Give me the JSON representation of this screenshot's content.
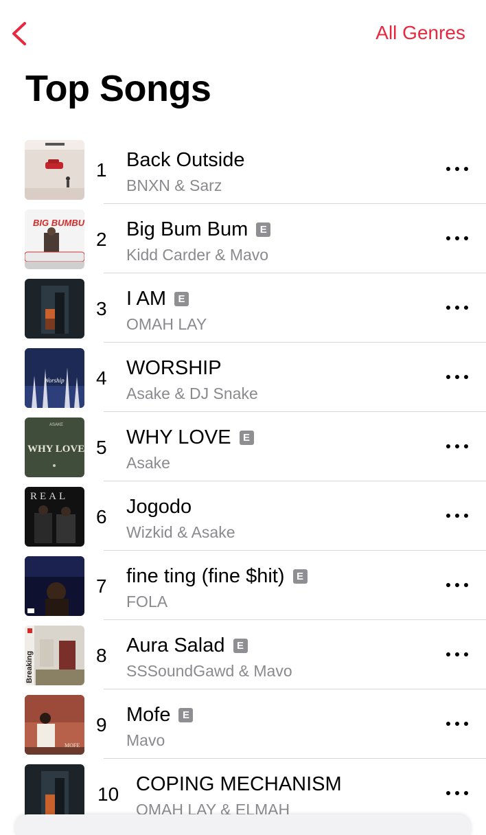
{
  "header": {
    "back_icon": "chevron-left-icon",
    "genres_label": "All Genres",
    "accent_color": "#e8283e"
  },
  "page": {
    "title": "Top Songs"
  },
  "songs": [
    {
      "rank": "1",
      "title": "Back Outside",
      "artist": "BNXN & Sarz",
      "explicit": false
    },
    {
      "rank": "2",
      "title": "Big Bum Bum",
      "artist": "Kidd Carder & Mavo",
      "explicit": true
    },
    {
      "rank": "3",
      "title": "I AM",
      "artist": "OMAH LAY",
      "explicit": true
    },
    {
      "rank": "4",
      "title": "WORSHIP",
      "artist": "Asake & DJ Snake",
      "explicit": false
    },
    {
      "rank": "5",
      "title": "WHY LOVE",
      "artist": "Asake",
      "explicit": true
    },
    {
      "rank": "6",
      "title": "Jogodo",
      "artist": "Wizkid & Asake",
      "explicit": false
    },
    {
      "rank": "7",
      "title": "fine ting (fine $hit)",
      "artist": "FOLA",
      "explicit": true
    },
    {
      "rank": "8",
      "title": "Aura Salad",
      "artist": "SSSoundGawd & Mavo",
      "explicit": true
    },
    {
      "rank": "9",
      "title": "Mofe",
      "artist": "Mavo",
      "explicit": true
    },
    {
      "rank": "10",
      "title": "COPING MECHANISM",
      "artist": "OMAH LAY & ELMAH",
      "explicit": false
    }
  ],
  "explicit_badge": "E",
  "artwork_text": {
    "big_bum_bum": "BIG BUMBUM",
    "worship": "Worship",
    "why_love": "WHY LOVE",
    "asake": "ASAKE",
    "real": "REAL",
    "breaking": "Breaking",
    "mofe": "MOFE"
  }
}
